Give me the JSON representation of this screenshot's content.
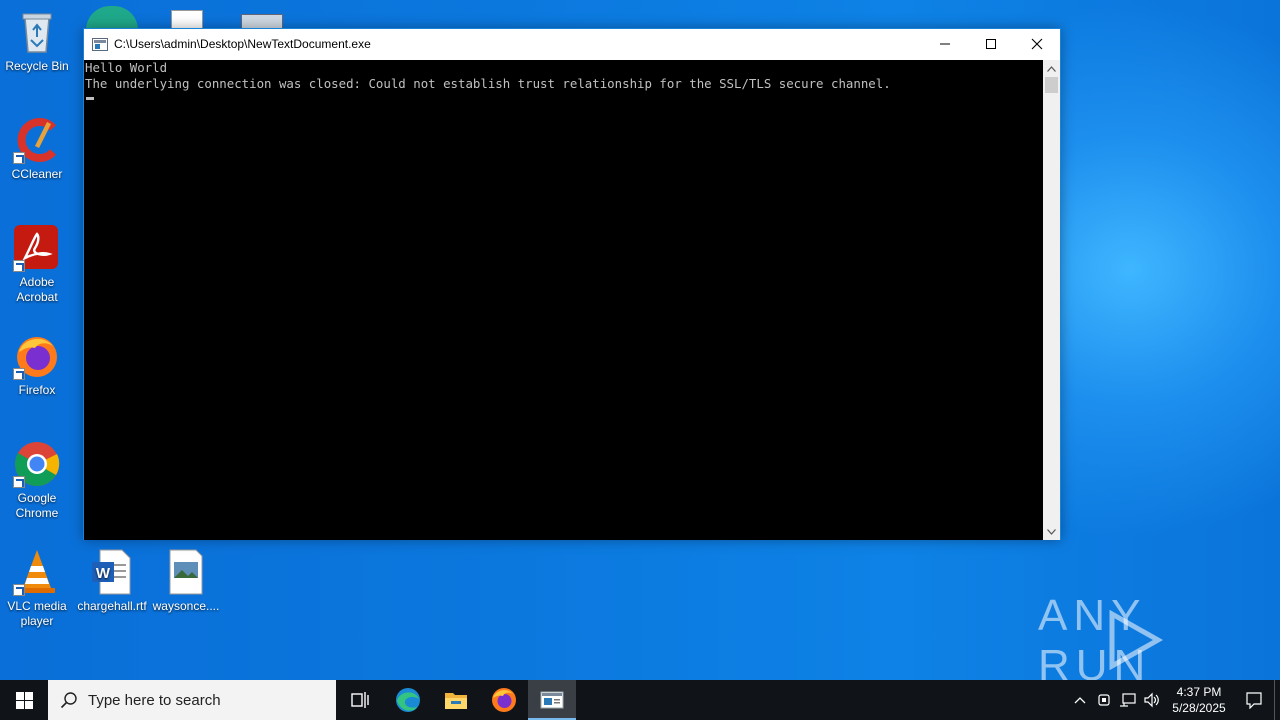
{
  "desktop": {
    "icons": [
      {
        "label": "Recycle Bin"
      },
      {
        "label": "CCleaner"
      },
      {
        "label": "Adobe Acrobat"
      },
      {
        "label": "Firefox"
      },
      {
        "label": "Google Chrome"
      },
      {
        "label": "VLC media player"
      },
      {
        "label": "chargehall.rtf"
      },
      {
        "label": "waysonce...."
      }
    ]
  },
  "window": {
    "title": "C:\\Users\\admin\\Desktop\\NewTextDocument.exe",
    "console_lines": [
      "Hello World",
      "The underlying connection was closed: Could not establish trust relationship for the SSL/TLS secure channel."
    ]
  },
  "watermark": {
    "text": "ANY RUN"
  },
  "taskbar": {
    "search_placeholder": "Type here to search",
    "time": "4:37 PM",
    "date": "5/28/2025"
  }
}
